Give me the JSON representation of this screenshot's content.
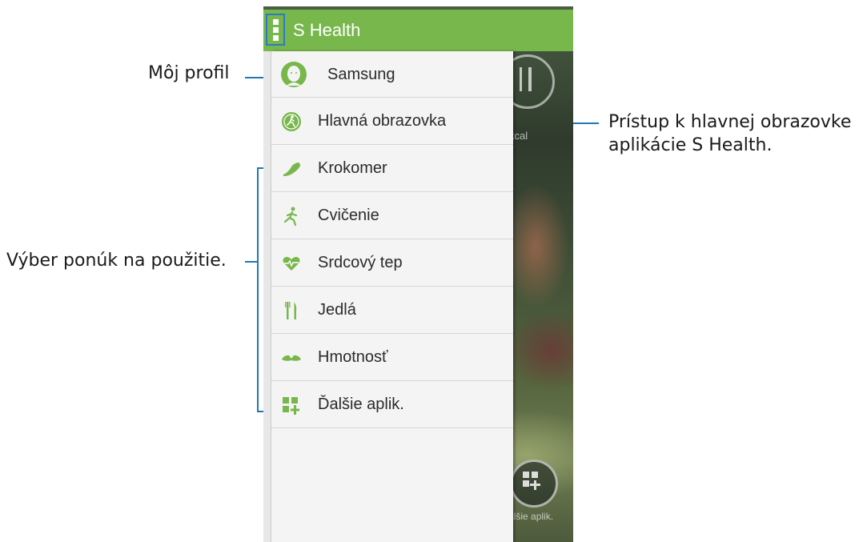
{
  "app": {
    "title": "S Health"
  },
  "background": {
    "kcal_label": "kcal",
    "more_apps_label": "alšie aplik."
  },
  "drawer": {
    "profile": {
      "name": "Samsung"
    },
    "items": [
      {
        "label": "Hlavná obrazovka",
        "icon": "home-icon"
      },
      {
        "label": "Krokomer",
        "icon": "shoe-icon"
      },
      {
        "label": "Cvičenie",
        "icon": "runner-icon"
      },
      {
        "label": "Srdcový tep",
        "icon": "heart-rate-icon"
      },
      {
        "label": "Jedlá",
        "icon": "fork-knife-icon"
      },
      {
        "label": "Hmotnosť",
        "icon": "scale-icon"
      },
      {
        "label": "Ďalšie aplik.",
        "icon": "more-apps-icon"
      }
    ]
  },
  "callouts": {
    "profile": "Môj profil",
    "home_line1": "Prístup k hlavnej obrazovke",
    "home_line2": "aplikácie S Health.",
    "menus": "Výber ponúk na použitie."
  },
  "colors": {
    "accent": "#77b74b",
    "callout_line": "#1f78b4"
  }
}
